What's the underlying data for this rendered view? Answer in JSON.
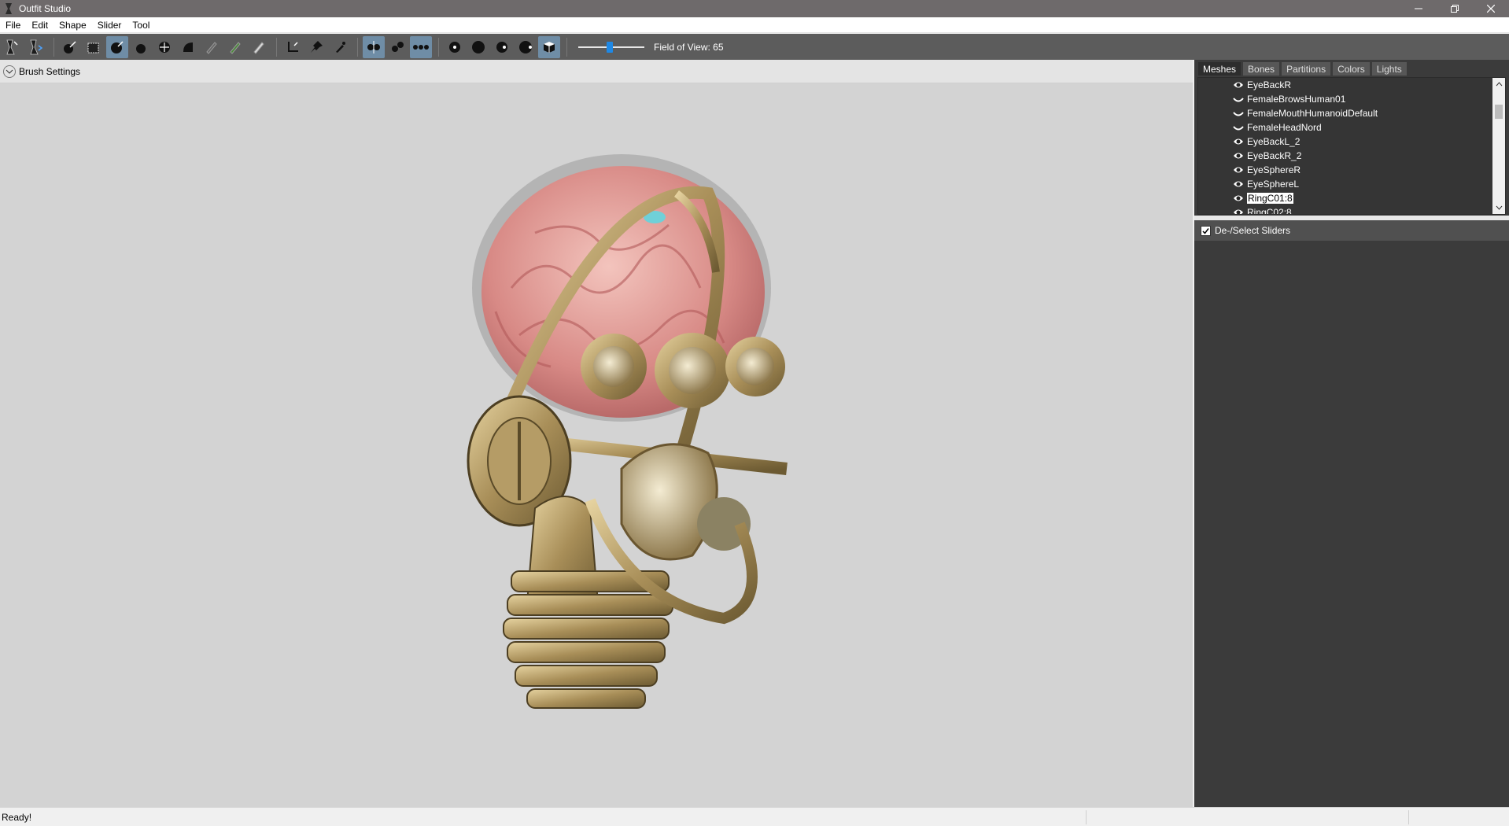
{
  "window": {
    "title": "Outfit Studio"
  },
  "menu": {
    "items": [
      "File",
      "Edit",
      "Shape",
      "Slider",
      "Tool"
    ]
  },
  "toolbar": {
    "fov_label": "Field of View: 65",
    "fov_value": 65,
    "buttons": [
      "select-tool-icon",
      "transform-tool-icon",
      "pivot-icon",
      "vertex-select-icon",
      "inflate-brush-icon",
      "deflate-brush-icon",
      "move-brush-icon",
      "smooth-brush-icon",
      "mask-brush-icon",
      "unmask-brush-icon",
      "weight-brush-icon",
      "anchor-icon",
      "pin-icon",
      "eyedropper-icon",
      "x-mirror-icon",
      "connected-only-icon",
      "global-brush-icon",
      "wireframe-icon",
      "lighting-icon",
      "texture-icon",
      "vertex-color-icon",
      "cube-icon"
    ]
  },
  "viewport": {
    "brush_settings_label": "Brush Settings"
  },
  "panel": {
    "tabs": [
      "Meshes",
      "Bones",
      "Partitions",
      "Colors",
      "Lights"
    ],
    "active_tab": "Meshes",
    "meshes": [
      {
        "name": "EyeBackR",
        "icon": "eye-icon"
      },
      {
        "name": "FemaleBrowsHuman01",
        "icon": "eye-closed-icon"
      },
      {
        "name": "FemaleMouthHumanoidDefault",
        "icon": "eye-closed-icon"
      },
      {
        "name": "FemaleHeadNord",
        "icon": "eye-closed-icon"
      },
      {
        "name": "EyeBackL_2",
        "icon": "eye-icon"
      },
      {
        "name": "EyeBackR_2",
        "icon": "eye-icon"
      },
      {
        "name": "EyeSphereR",
        "icon": "eye-icon"
      },
      {
        "name": "EyeSphereL",
        "icon": "eye-icon"
      },
      {
        "name": "RingC01:8",
        "icon": "eye-icon",
        "selected": true
      },
      {
        "name": "RingC02:8",
        "icon": "eye-icon"
      }
    ],
    "sliders_header": "De-/Select Sliders",
    "sliders_checked": true
  },
  "status": {
    "text": "Ready!"
  },
  "colors": {
    "titlebar": "#6e6a6b",
    "toolbar": "#5c5c5c",
    "viewport": "#d3d3d3",
    "panel": "#3b3b3b",
    "accent": "#1e88e5"
  }
}
